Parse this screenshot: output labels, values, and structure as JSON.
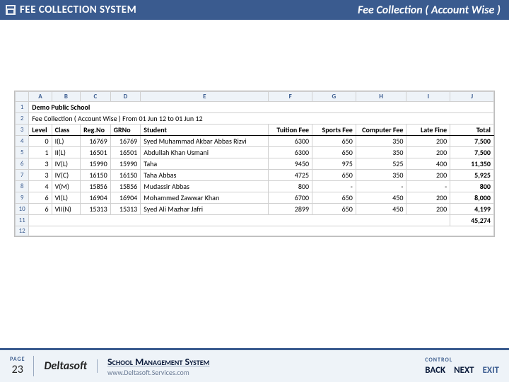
{
  "header": {
    "title_left": "FEE COLLECTION SYSTEM",
    "title_right": "Fee Collection ( Account Wise )"
  },
  "report": {
    "school": "Demo Public School",
    "subtitle": "Fee Collection ( Account Wise ) From 01 Jun 12 to 01 Jun 12",
    "col_letters": [
      "",
      "A",
      "B",
      "C",
      "D",
      "E",
      "F",
      "G",
      "H",
      "I",
      "J"
    ],
    "columns": [
      "Level",
      "Class",
      "Reg.No",
      "GRNo",
      "Student",
      "Tuition Fee",
      "Sports Fee",
      "Computer Fee",
      "Late Fine",
      "Total"
    ]
  },
  "rows": [
    {
      "n": 4,
      "level": "0",
      "class": "I(L)",
      "reg": "16769",
      "gr": "16769",
      "student": "Syed Muhammad Akbar Abbas Rizvi",
      "tf": "6300",
      "sf": "650",
      "cf": "350",
      "lf": "200",
      "total": "7,500"
    },
    {
      "n": 5,
      "level": "1",
      "class": "II(L)",
      "reg": "16501",
      "gr": "16501",
      "student": "Abdullah Khan Usmani",
      "tf": "6300",
      "sf": "650",
      "cf": "350",
      "lf": "200",
      "total": "7,500"
    },
    {
      "n": 6,
      "level": "3",
      "class": "IV(L)",
      "reg": "15990",
      "gr": "15990",
      "student": "Taha",
      "tf": "9450",
      "sf": "975",
      "cf": "525",
      "lf": "400",
      "total": "11,350"
    },
    {
      "n": 7,
      "level": "3",
      "class": "IV(C)",
      "reg": "16150",
      "gr": "16150",
      "student": "Taha Abbas",
      "tf": "4725",
      "sf": "650",
      "cf": "350",
      "lf": "200",
      "total": "5,925"
    },
    {
      "n": 8,
      "level": "4",
      "class": "V(M)",
      "reg": "15856",
      "gr": "15856",
      "student": "Mudassir Abbas",
      "tf": "800",
      "sf": "-",
      "cf": "-",
      "lf": "-",
      "total": "800"
    },
    {
      "n": 9,
      "level": "6",
      "class": "VI(L)",
      "reg": "16904",
      "gr": "16904",
      "student": "Mohammed Zawwar Khan",
      "tf": "6700",
      "sf": "650",
      "cf": "450",
      "lf": "200",
      "total": "8,000"
    },
    {
      "n": 10,
      "level": "6",
      "class": "VII(N)",
      "reg": "15313",
      "gr": "15313",
      "student": "Syed Ali Mazhar Jafri",
      "tf": "2899",
      "sf": "650",
      "cf": "450",
      "lf": "200",
      "total": "4,199"
    }
  ],
  "grand_total": "45,274",
  "footer": {
    "page_label": "PAGE",
    "page_num": "23",
    "brand": "Deltasoft",
    "sys_title": "School Management System",
    "sys_url": "www.Deltasoft.Services.com",
    "control_label": "CONTROL",
    "back": "BACK",
    "next": "NEXT",
    "exit": "EXIT"
  }
}
